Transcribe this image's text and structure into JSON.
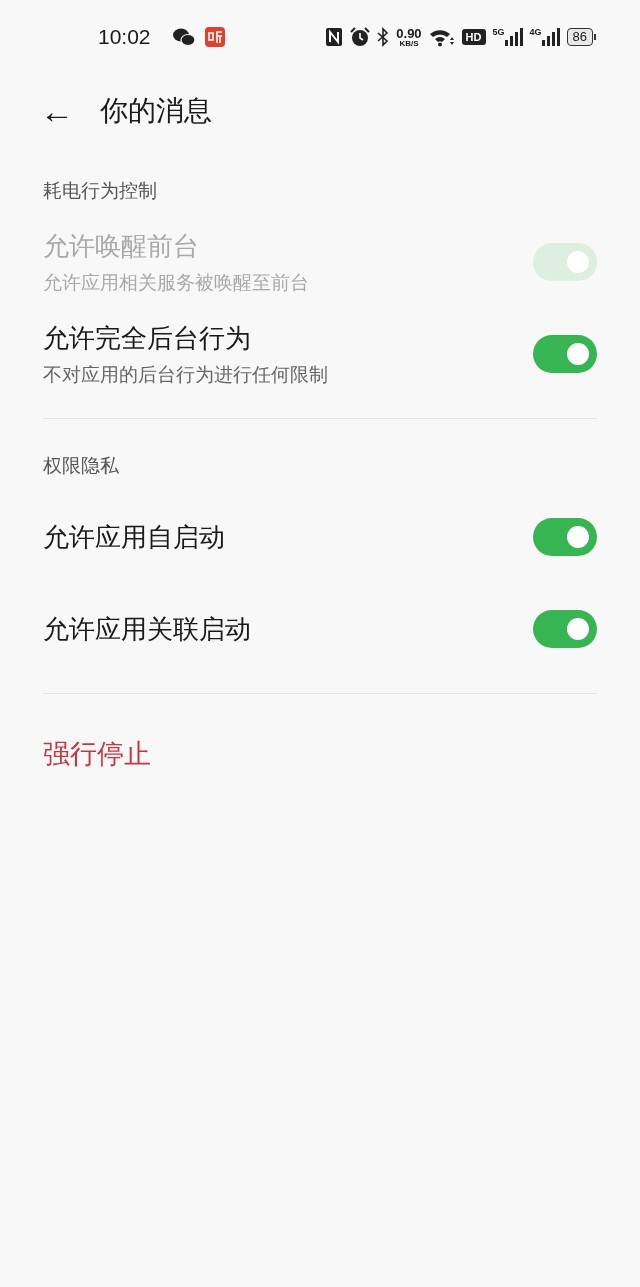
{
  "status_bar": {
    "time": "10:02",
    "net_speed": "0.90",
    "net_unit": "KB/S",
    "hd_badge": "HD",
    "sim1": "5G",
    "sim2": "4G",
    "battery": "86"
  },
  "header": {
    "back": "←",
    "title": "你的消息"
  },
  "sections": [
    {
      "title": "耗电行为控制",
      "items": [
        {
          "title": "允许唤醒前台",
          "subtitle": "允许应用相关服务被唤醒至前台",
          "on": true,
          "disabled": true
        },
        {
          "title": "允许完全后台行为",
          "subtitle": "不对应用的后台行为进行任何限制",
          "on": true,
          "disabled": false
        }
      ]
    },
    {
      "title": "权限隐私",
      "items": [
        {
          "title": "允许应用自启动",
          "on": true,
          "disabled": false
        },
        {
          "title": "允许应用关联启动",
          "on": true,
          "disabled": false
        }
      ]
    }
  ],
  "action": {
    "label": "强行停止",
    "kind": "danger"
  }
}
